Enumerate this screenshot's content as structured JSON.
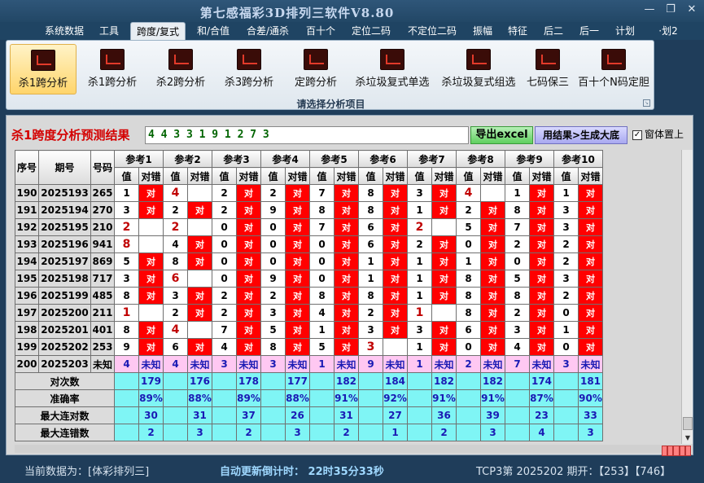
{
  "window": {
    "title": "第七感福彩3D排列三软件V8.80",
    "minimize": "—",
    "restore": "❐",
    "close": "✕"
  },
  "menu": [
    "系统数据",
    "工具",
    "跨度/复式",
    "和/合值",
    "合差/通杀",
    "百十个",
    "定位二码",
    "不定位二码",
    "振幅",
    "特征",
    "后二",
    "后一",
    "计划",
    "·划2"
  ],
  "menu_active": "跨度/复式",
  "ribbon": {
    "buttons": [
      "杀1跨分析",
      "杀1跨分析",
      "杀2跨分析",
      "杀3跨分析",
      "定跨分析",
      "杀垃圾复式单选",
      "杀垃圾复式组选",
      "七码保三",
      "百十个N码定胆"
    ],
    "selected": 0,
    "caption": "请选择分析项目",
    "expand": "↘"
  },
  "panel": {
    "title": "杀1跨度分析预测结果",
    "result": "4 4 3 3 1 9 1 2 7 3",
    "export_label": "导出excel",
    "generate_label": "用结果>生成大底",
    "ontop_label": "窗体置上",
    "ontop_checked": "✓"
  },
  "table": {
    "head_seq": "序号",
    "head_issue": "期号",
    "head_code": "号码",
    "refs": [
      "参考1",
      "参考2",
      "参考3",
      "参考4",
      "参考5",
      "参考6",
      "参考7",
      "参考8",
      "参考9",
      "参考10"
    ],
    "sub_val": "值",
    "sub_hit": "对错",
    "hit_text": "对",
    "rows": [
      {
        "seq": "190",
        "issue": "2025193",
        "code": "265",
        "vals": [
          "1",
          "4",
          "2",
          "2",
          "7",
          "8",
          "3",
          "4",
          "1",
          "1"
        ],
        "hits": [
          1,
          0,
          1,
          1,
          1,
          1,
          1,
          0,
          1,
          1
        ],
        "hi": [
          0,
          1,
          0,
          0,
          0,
          0,
          0,
          1,
          0,
          0
        ]
      },
      {
        "seq": "191",
        "issue": "2025194",
        "code": "270",
        "vals": [
          "3",
          "2",
          "2",
          "9",
          "8",
          "8",
          "1",
          "2",
          "8",
          "3"
        ],
        "hits": [
          1,
          1,
          1,
          1,
          1,
          1,
          1,
          1,
          1,
          1
        ],
        "hi": [
          0,
          0,
          0,
          0,
          0,
          0,
          0,
          0,
          0,
          0
        ]
      },
      {
        "seq": "192",
        "issue": "2025195",
        "code": "210",
        "vals": [
          "2",
          "2",
          "0",
          "0",
          "7",
          "6",
          "2",
          "5",
          "7",
          "3"
        ],
        "hits": [
          0,
          0,
          1,
          1,
          1,
          1,
          0,
          1,
          1,
          1
        ],
        "hi": [
          1,
          1,
          0,
          0,
          0,
          0,
          1,
          0,
          0,
          0
        ]
      },
      {
        "seq": "193",
        "issue": "2025196",
        "code": "941",
        "vals": [
          "8",
          "4",
          "0",
          "0",
          "0",
          "6",
          "2",
          "0",
          "2",
          "2"
        ],
        "hits": [
          0,
          1,
          1,
          1,
          1,
          1,
          1,
          1,
          1,
          1
        ],
        "hi": [
          1,
          0,
          0,
          0,
          0,
          0,
          0,
          0,
          0,
          0
        ]
      },
      {
        "seq": "194",
        "issue": "2025197",
        "code": "869",
        "vals": [
          "5",
          "8",
          "0",
          "0",
          "0",
          "1",
          "1",
          "1",
          "0",
          "2"
        ],
        "hits": [
          1,
          1,
          1,
          1,
          1,
          1,
          1,
          1,
          1,
          1
        ],
        "hi": [
          0,
          0,
          0,
          0,
          0,
          0,
          0,
          0,
          0,
          0
        ]
      },
      {
        "seq": "195",
        "issue": "2025198",
        "code": "717",
        "vals": [
          "3",
          "6",
          "0",
          "9",
          "0",
          "1",
          "1",
          "8",
          "5",
          "3"
        ],
        "hits": [
          1,
          0,
          1,
          1,
          1,
          1,
          1,
          1,
          1,
          1
        ],
        "hi": [
          0,
          1,
          0,
          0,
          0,
          0,
          0,
          0,
          0,
          0
        ]
      },
      {
        "seq": "196",
        "issue": "2025199",
        "code": "485",
        "vals": [
          "8",
          "3",
          "2",
          "2",
          "8",
          "8",
          "1",
          "8",
          "8",
          "2"
        ],
        "hits": [
          1,
          1,
          1,
          1,
          1,
          1,
          1,
          1,
          1,
          1
        ],
        "hi": [
          0,
          0,
          0,
          0,
          0,
          0,
          0,
          0,
          0,
          0
        ]
      },
      {
        "seq": "197",
        "issue": "2025200",
        "code": "211",
        "vals": [
          "1",
          "2",
          "2",
          "3",
          "4",
          "2",
          "1",
          "8",
          "2",
          "0"
        ],
        "hits": [
          0,
          1,
          1,
          1,
          1,
          1,
          0,
          1,
          1,
          1
        ],
        "hi": [
          1,
          0,
          0,
          0,
          0,
          0,
          1,
          0,
          0,
          0
        ]
      },
      {
        "seq": "198",
        "issue": "2025201",
        "code": "401",
        "vals": [
          "8",
          "4",
          "7",
          "5",
          "1",
          "3",
          "3",
          "6",
          "3",
          "1"
        ],
        "hits": [
          1,
          0,
          1,
          1,
          1,
          1,
          1,
          1,
          1,
          1
        ],
        "hi": [
          0,
          1,
          0,
          0,
          0,
          0,
          0,
          0,
          0,
          0
        ]
      },
      {
        "seq": "199",
        "issue": "2025202",
        "code": "253",
        "vals": [
          "9",
          "6",
          "4",
          "8",
          "5",
          "3",
          "1",
          "0",
          "4",
          "0"
        ],
        "hits": [
          1,
          1,
          1,
          1,
          1,
          0,
          1,
          1,
          1,
          1
        ],
        "hi": [
          0,
          0,
          0,
          0,
          0,
          1,
          0,
          0,
          0,
          0
        ]
      }
    ],
    "future": {
      "seq": "200",
      "issue": "2025203",
      "code": "未知",
      "vals": [
        "4",
        "4",
        "3",
        "3",
        "1",
        "9",
        "1",
        "2",
        "7",
        "3"
      ],
      "hit_text": "未知"
    },
    "stats": [
      {
        "label": "对次数",
        "vals": [
          "179",
          "176",
          "178",
          "177",
          "182",
          "184",
          "182",
          "182",
          "174",
          "181"
        ]
      },
      {
        "label": "准确率",
        "vals": [
          "89%",
          "88%",
          "89%",
          "88%",
          "91%",
          "92%",
          "91%",
          "91%",
          "87%",
          "90%"
        ]
      },
      {
        "label": "最大连对数",
        "vals": [
          "30",
          "31",
          "37",
          "26",
          "31",
          "27",
          "36",
          "39",
          "23",
          "33"
        ]
      },
      {
        "label": "最大连错数",
        "vals": [
          "2",
          "3",
          "2",
          "3",
          "2",
          "1",
          "2",
          "3",
          "4",
          "3"
        ]
      }
    ]
  },
  "scroll": {
    "down": "▼"
  },
  "status": {
    "source": "当前数据为：[体彩排列三]",
    "countdown": "自动更新倒计时：  22时35分33秒",
    "issue": "TCP3第 2025202 期开：【253】【746】"
  },
  "colors": {
    "hit": "#ff0000",
    "future": "#ffc8f2",
    "stat": "#7ff5f5",
    "title_red": "#d40000"
  }
}
